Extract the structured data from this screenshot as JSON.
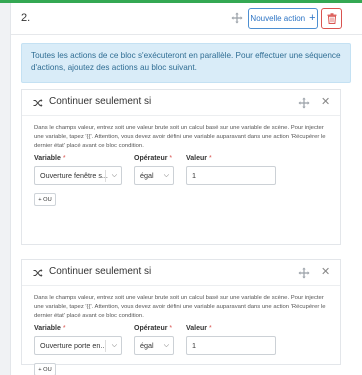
{
  "block": {
    "number": "2.",
    "new_action_label": "Nouvelle action",
    "info": "Toutes les actions de ce bloc s'exécuteront en parallèle. Pour effectuer une séquence d'actions, ajoutez des actions au bloc suivant."
  },
  "conditions": [
    {
      "title": "Continuer seulement si",
      "description": "Dans le champs valeur, entrez soit une valeur brute soit un calcul basé sur une variable de scène. Pour injecter une variable, tapez '{{'. Attention, vous devez avoir défini une variable auparavant dans une action 'Récupérer le dernier état' placé avant ce bloc condition.",
      "variable_label": "Variable",
      "variable_value": "Ouverture fenêtre s...",
      "operator_label": "Opérateur",
      "operator_value": "égal",
      "value_label": "Valeur",
      "value_value": "1",
      "required_mark": "*",
      "or_label": "+ OU"
    },
    {
      "title": "Continuer seulement si",
      "description": "Dans le champs valeur, entrez soit une valeur brute soit un calcul basé sur une variable de scène. Pour injecter une variable, tapez '{{'. Attention, vous devez avoir défini une variable auparavant dans une action 'Récupérer le dernier état' placé avant ce bloc condition.",
      "variable_label": "Variable",
      "variable_value": "Ouverture porte en...",
      "operator_label": "Opérateur",
      "operator_value": "égal",
      "value_label": "Valeur",
      "value_value": "1",
      "required_mark": "*",
      "or_label": "+ OU"
    }
  ],
  "icons": {
    "move": "move-icon",
    "plus": "plus-icon",
    "trash": "trash-icon",
    "shuffle": "shuffle-icon",
    "close": "close-icon",
    "chevron": "chevron-down-icon"
  },
  "colors": {
    "accent_green": "#34a853",
    "primary_blue": "#2b73c4",
    "danger_red": "#d9534f",
    "info_bg": "#d9ecf8"
  }
}
